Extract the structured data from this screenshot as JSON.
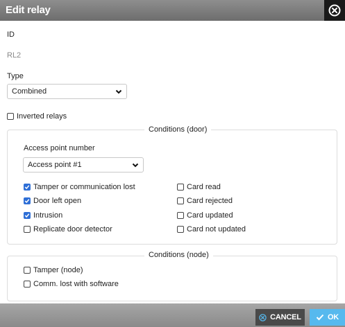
{
  "dialog": {
    "title": "Edit relay"
  },
  "form": {
    "id_label": "ID",
    "id_value": "RL2",
    "type_label": "Type",
    "type_value": "Combined",
    "inverted_label": "Inverted relays",
    "inverted_checked": false
  },
  "conditions_door": {
    "legend": "Conditions (door)",
    "access_point_label": "Access point number",
    "access_point_value": "Access point #1",
    "left": [
      {
        "label": "Tamper or communication lost",
        "checked": true
      },
      {
        "label": "Door left open",
        "checked": true
      },
      {
        "label": "Intrusion",
        "checked": true
      },
      {
        "label": "Replicate door detector",
        "checked": false
      }
    ],
    "right": [
      {
        "label": "Card read",
        "checked": false
      },
      {
        "label": "Card rejected",
        "checked": false
      },
      {
        "label": "Card updated",
        "checked": false
      },
      {
        "label": "Card not updated",
        "checked": false
      }
    ]
  },
  "conditions_node": {
    "legend": "Conditions (node)",
    "items": [
      {
        "label": "Tamper (node)",
        "checked": false
      },
      {
        "label": "Comm. lost with software",
        "checked": false
      }
    ]
  },
  "footer": {
    "cancel_label": "CANCEL",
    "ok_label": "OK"
  },
  "colors": {
    "accent": "#2f6fd6",
    "ok_button": "#56b9ee",
    "cancel_button": "#4a4a4a",
    "titlebar": "#7a7a7a"
  },
  "icons": {
    "close": "close-circle-icon",
    "dropdown": "chevron-down-icon",
    "cancel": "cancel-circle-icon",
    "ok": "checkmark-icon"
  }
}
